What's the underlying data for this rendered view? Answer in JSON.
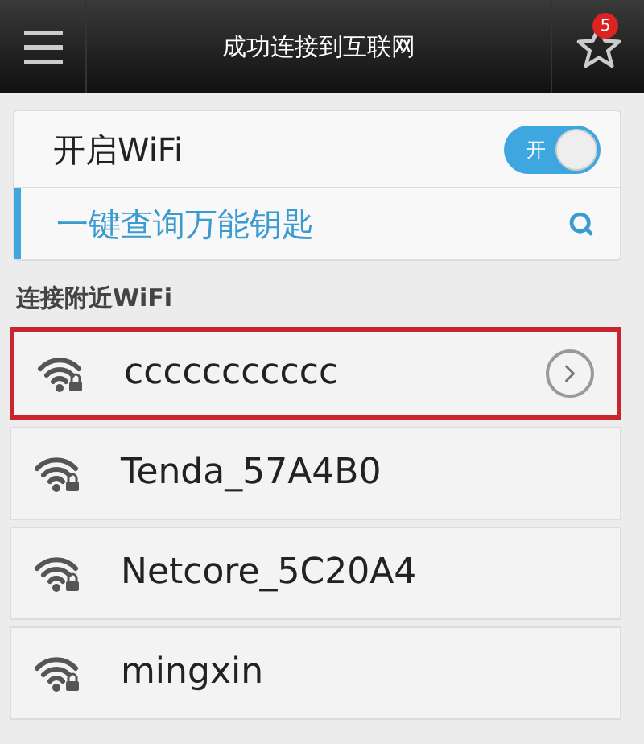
{
  "header": {
    "title": "成功连接到互联网",
    "badge": "5"
  },
  "wifi_toggle": {
    "label": "开启WiFi",
    "on": true,
    "switch_text": "开"
  },
  "key_search": {
    "label": "一键查询万能钥匙"
  },
  "section_title": "连接附近WiFi",
  "networks": [
    {
      "name": "ccccccccccc",
      "selected": true
    },
    {
      "name": "Tenda_57A4B0",
      "selected": false
    },
    {
      "name": "Netcore_5C20A4",
      "selected": false
    },
    {
      "name": "mingxin",
      "selected": false
    }
  ]
}
